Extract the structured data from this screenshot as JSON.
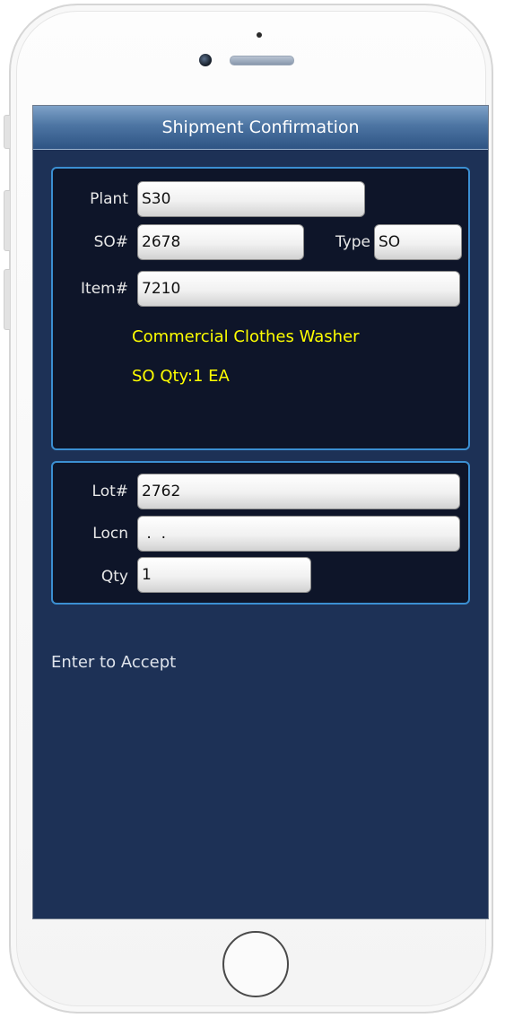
{
  "screen": {
    "title": "Shipment Confirmation"
  },
  "header_panel": {
    "plant_label": "Plant",
    "plant_value": "S30",
    "so_label": "SO#",
    "so_value": "2678",
    "type_label": "Type",
    "type_value": "SO",
    "item_label": "Item#",
    "item_value": "7210",
    "item_description": "Commercial Clothes Washer",
    "so_qty": "SO Qty:1 EA"
  },
  "detail_panel": {
    "lot_label": "Lot#",
    "lot_value": "2762",
    "locn_label": "Locn",
    "locn_value": " .  .",
    "qty_label": "Qty",
    "qty_value": "1"
  },
  "footer": {
    "prompt": "Enter to Accept"
  },
  "colors": {
    "screen_background": "#1d3156",
    "panel_background": "#0e1529",
    "panel_border": "#3b8fd2",
    "highlight_text": "#ffff00"
  }
}
